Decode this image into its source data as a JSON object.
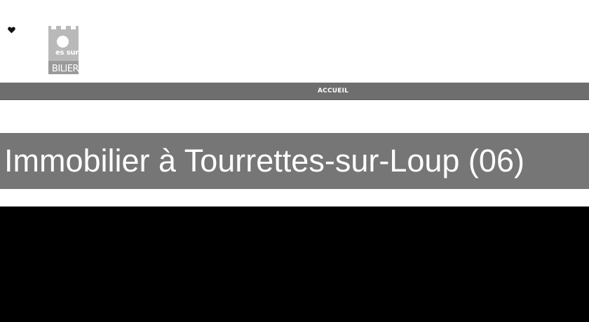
{
  "header": {
    "logo": {
      "line1": "es sur",
      "line2": "BILIER"
    }
  },
  "navbar": {
    "items": [
      {
        "label": "ACCUEIL"
      }
    ]
  },
  "main": {
    "title": "Immobilier à Tourrettes-sur-Loup (06)"
  },
  "colors": {
    "navbar": "#6e6e6e",
    "title_band": "#767676",
    "logo": "#b9b9b9",
    "bottom_area": "#000000"
  }
}
